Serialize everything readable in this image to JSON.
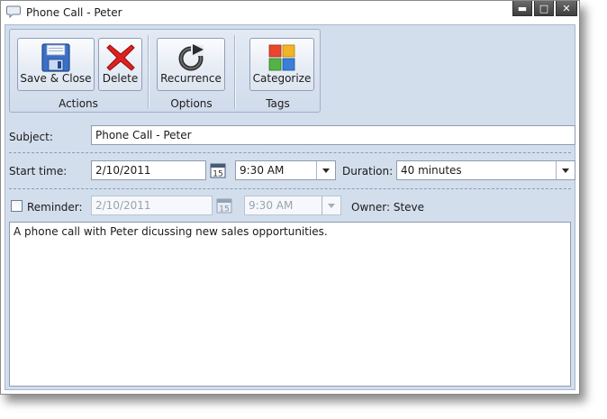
{
  "window": {
    "title": "Phone Call - Peter",
    "controls": {
      "minimize": "▬",
      "maximize": "□",
      "close": "✕"
    }
  },
  "ribbon": {
    "groups": [
      {
        "label": "Actions",
        "buttons": [
          {
            "label": "Save & Close",
            "icon": "floppy-disk-icon"
          },
          {
            "label": "Delete",
            "icon": "red-x-icon"
          }
        ]
      },
      {
        "label": "Options",
        "buttons": [
          {
            "label": "Recurrence",
            "icon": "recurrence-arrow-icon"
          }
        ]
      },
      {
        "label": "Tags",
        "buttons": [
          {
            "label": "Categorize",
            "icon": "color-squares-icon"
          }
        ]
      }
    ]
  },
  "form": {
    "subject": {
      "label": "Subject:",
      "value": "Phone Call - Peter"
    },
    "start": {
      "label": "Start time:",
      "date": "2/10/2011",
      "calendar_day": "15",
      "time": "9:30 AM"
    },
    "duration": {
      "label": "Duration:",
      "value": "40 minutes"
    },
    "reminder": {
      "label": "Reminder:",
      "checked": false,
      "date": "2/10/2011",
      "calendar_day": "15",
      "time": "9:30 AM"
    },
    "owner": {
      "text": "Owner: Steve"
    },
    "notes": "A phone call with Peter dicussing new sales opportunities."
  },
  "colors": {
    "panel": "#d3deed",
    "accent_red": "#e02020",
    "floppy_blue": "#3a6fc4"
  }
}
